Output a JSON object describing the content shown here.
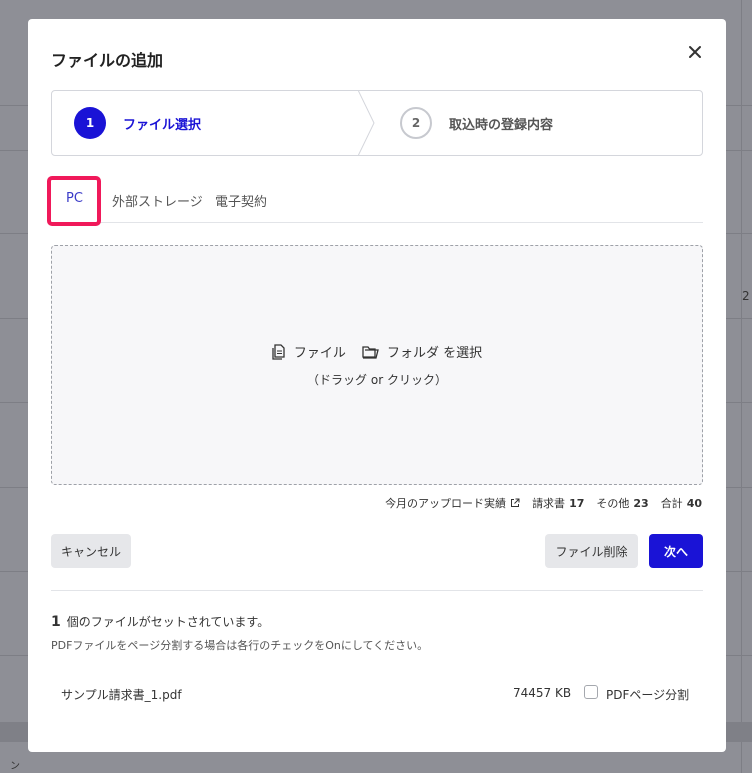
{
  "background": {
    "fragment_row": "2",
    "fragment_bottom": "ン"
  },
  "modal": {
    "title": "ファイルの追加",
    "close_icon": "close-icon"
  },
  "stepper": {
    "steps": [
      {
        "number": "1",
        "label": "ファイル選択",
        "state": "active"
      },
      {
        "number": "2",
        "label": "取込時の登録内容",
        "state": "inactive"
      }
    ]
  },
  "tabs": [
    {
      "label": "PC",
      "active": true
    },
    {
      "label": "外部ストレージ",
      "active": false
    },
    {
      "label": "電子契約",
      "active": false
    }
  ],
  "dropzone": {
    "file_label": "ファイル",
    "folder_label": "フォルダ を選択",
    "hint": "（ドラッグ or クリック）",
    "file_icon": "file-icon",
    "folder_icon": "folder-icon"
  },
  "stats": {
    "uploads_label": "今月のアップロード実績",
    "invoice_label": "請求書",
    "invoice_count": "17",
    "other_label": "その他",
    "other_count": "23",
    "total_label": "合計",
    "total_count": "40"
  },
  "buttons": {
    "cancel": "キャンセル",
    "delete": "ファイル削除",
    "next": "次へ"
  },
  "summary": {
    "count": "1",
    "count_text": "個のファイルがセットされています。",
    "note": "PDFファイルをページ分割する場合は各行のチェックをOnにしてください。"
  },
  "files": [
    {
      "name": "サンプル請求書_1.pdf",
      "size": "74457 KB",
      "split_label": "PDFページ分割",
      "split_checked": false
    }
  ],
  "colors": {
    "accent": "#1a13d6",
    "highlight": "#f0195a",
    "overlay": "#8e8f96"
  }
}
